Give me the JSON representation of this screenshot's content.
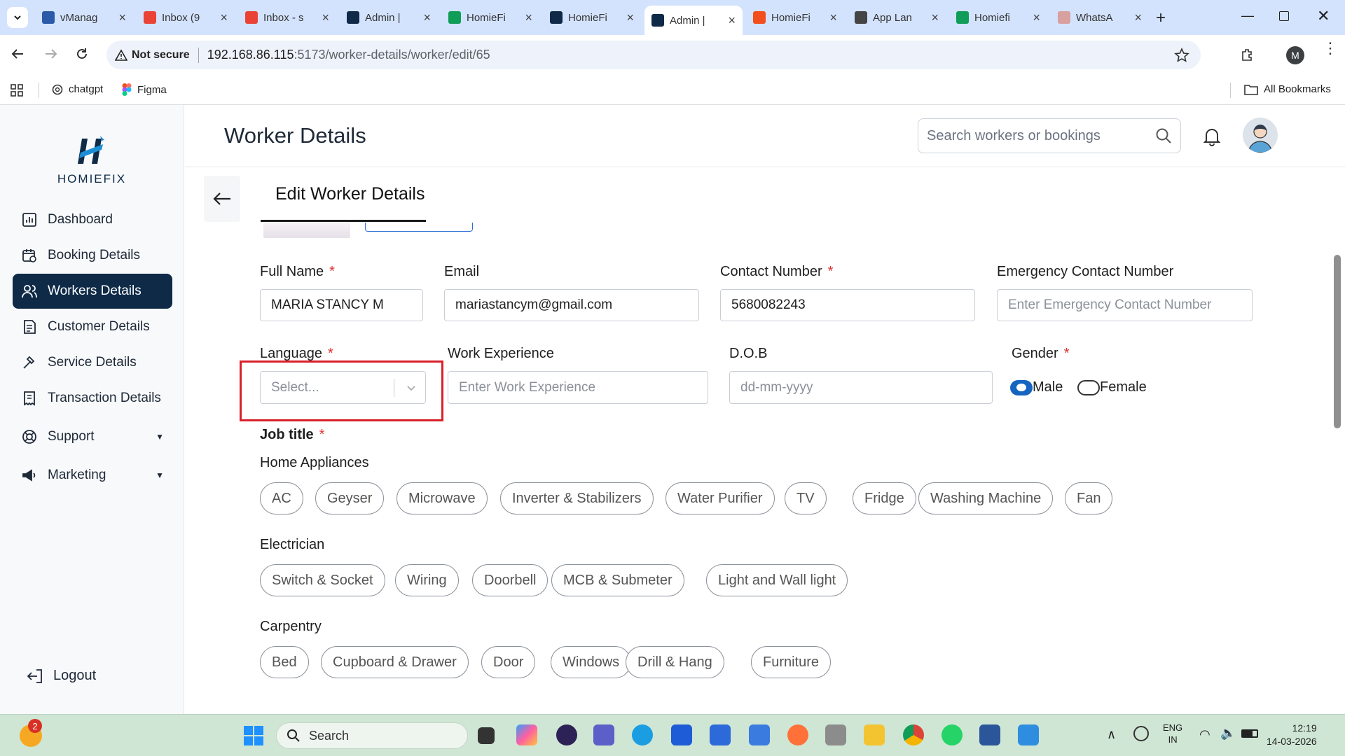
{
  "browser": {
    "tabs": [
      {
        "title": "vManag",
        "favicon": "vmanage",
        "color": "#2b5aa8"
      },
      {
        "title": "Inbox (9",
        "favicon": "gmail",
        "color": "#ea4335"
      },
      {
        "title": "Inbox - s",
        "favicon": "gmail",
        "color": "#ea4335"
      },
      {
        "title": "Admin |",
        "favicon": "homiefix",
        "color": "#0e2a47"
      },
      {
        "title": "HomieFi",
        "favicon": "sheets",
        "color": "#0f9d58"
      },
      {
        "title": "HomieFi",
        "favicon": "homiefix",
        "color": "#0e2a47"
      },
      {
        "title": "Admin |",
        "favicon": "homiefix",
        "color": "#0e2a47"
      },
      {
        "title": "HomieFi",
        "favicon": "figma",
        "color": "#f24e1e"
      },
      {
        "title": "App Lan",
        "favicon": "chatgpt",
        "color": "#444"
      },
      {
        "title": "Homiefi",
        "favicon": "sheets",
        "color": "#0f9d58"
      },
      {
        "title": "WhatsA",
        "favicon": "whatsapp",
        "color": "#d9a0a0"
      }
    ],
    "active_tab_index": 6,
    "security_label": "Not secure",
    "url_host": "192.168.86.115",
    "url_rest": ":5173/worker-details/worker/edit/65",
    "profile_initial": "M",
    "bookmarks": [
      {
        "label": "chatgpt",
        "icon": "chatgpt-icon"
      },
      {
        "label": "Figma",
        "icon": "figma-icon"
      }
    ],
    "all_bookmarks_label": "All Bookmarks"
  },
  "app": {
    "brand": "HOMIEFIX",
    "page_title": "Worker Details",
    "search_placeholder": "Search workers or bookings",
    "nav": [
      {
        "label": "Dashboard",
        "icon": "dashboard-icon",
        "active": false
      },
      {
        "label": "Booking Details",
        "icon": "calendar-icon",
        "active": false
      },
      {
        "label": "Workers Details",
        "icon": "users-icon",
        "active": true
      },
      {
        "label": "Customer Details",
        "icon": "document-icon",
        "active": false
      },
      {
        "label": "Service Details",
        "icon": "hammer-icon",
        "active": false
      },
      {
        "label": "Transaction Details",
        "icon": "receipt-icon",
        "active": false
      },
      {
        "label": "Support",
        "icon": "support-icon",
        "active": false,
        "has_caret": true
      },
      {
        "label": "Marketing",
        "icon": "megaphone-icon",
        "active": false,
        "has_caret": true
      }
    ],
    "logout_label": "Logout",
    "form_tab": "Edit Worker Details",
    "fields": {
      "full_name": {
        "label": "Full Name",
        "value": "MARIA STANCY M",
        "required": true
      },
      "email": {
        "label": "Email",
        "value": "mariastancym@gmail.com",
        "required": false
      },
      "contact": {
        "label": "Contact Number",
        "value": "5680082243",
        "required": true
      },
      "emergency": {
        "label": "Emergency Contact Number",
        "placeholder": "Enter Emergency Contact Number",
        "required": false
      },
      "language": {
        "label": "Language",
        "placeholder": "Select...",
        "required": true
      },
      "experience": {
        "label": "Work Experience",
        "placeholder": "Enter Work Experience",
        "required": false
      },
      "dob": {
        "label": "D.O.B",
        "placeholder": "dd-mm-yyyy",
        "required": false
      },
      "gender": {
        "label": "Gender",
        "options": [
          "Male",
          "Female"
        ],
        "selected": "Male",
        "required": true
      }
    },
    "job_title_label": "Job title",
    "highlight_color": "#d9202a",
    "categories": [
      {
        "name": "Home Appliances",
        "items": [
          "AC",
          "Geyser",
          "Microwave",
          "Inverter & Stabilizers",
          "Water Purifier",
          "TV",
          "Fridge",
          "Washing Machine",
          "Fan"
        ]
      },
      {
        "name": "Electrician",
        "items": [
          "Switch & Socket",
          "Wiring",
          "Doorbell",
          "MCB & Submeter",
          "Light and Wall light"
        ]
      },
      {
        "name": "Carpentry",
        "items": [
          "Bed",
          "Cupboard & Drawer",
          "Door",
          "Windows",
          "Drill & Hang",
          "Furniture"
        ]
      }
    ]
  },
  "taskbar": {
    "notification_count": "2",
    "search_placeholder": "Search",
    "lang_line1": "ENG",
    "lang_line2": "IN",
    "time": "12:19",
    "date": "14-03-2026"
  }
}
